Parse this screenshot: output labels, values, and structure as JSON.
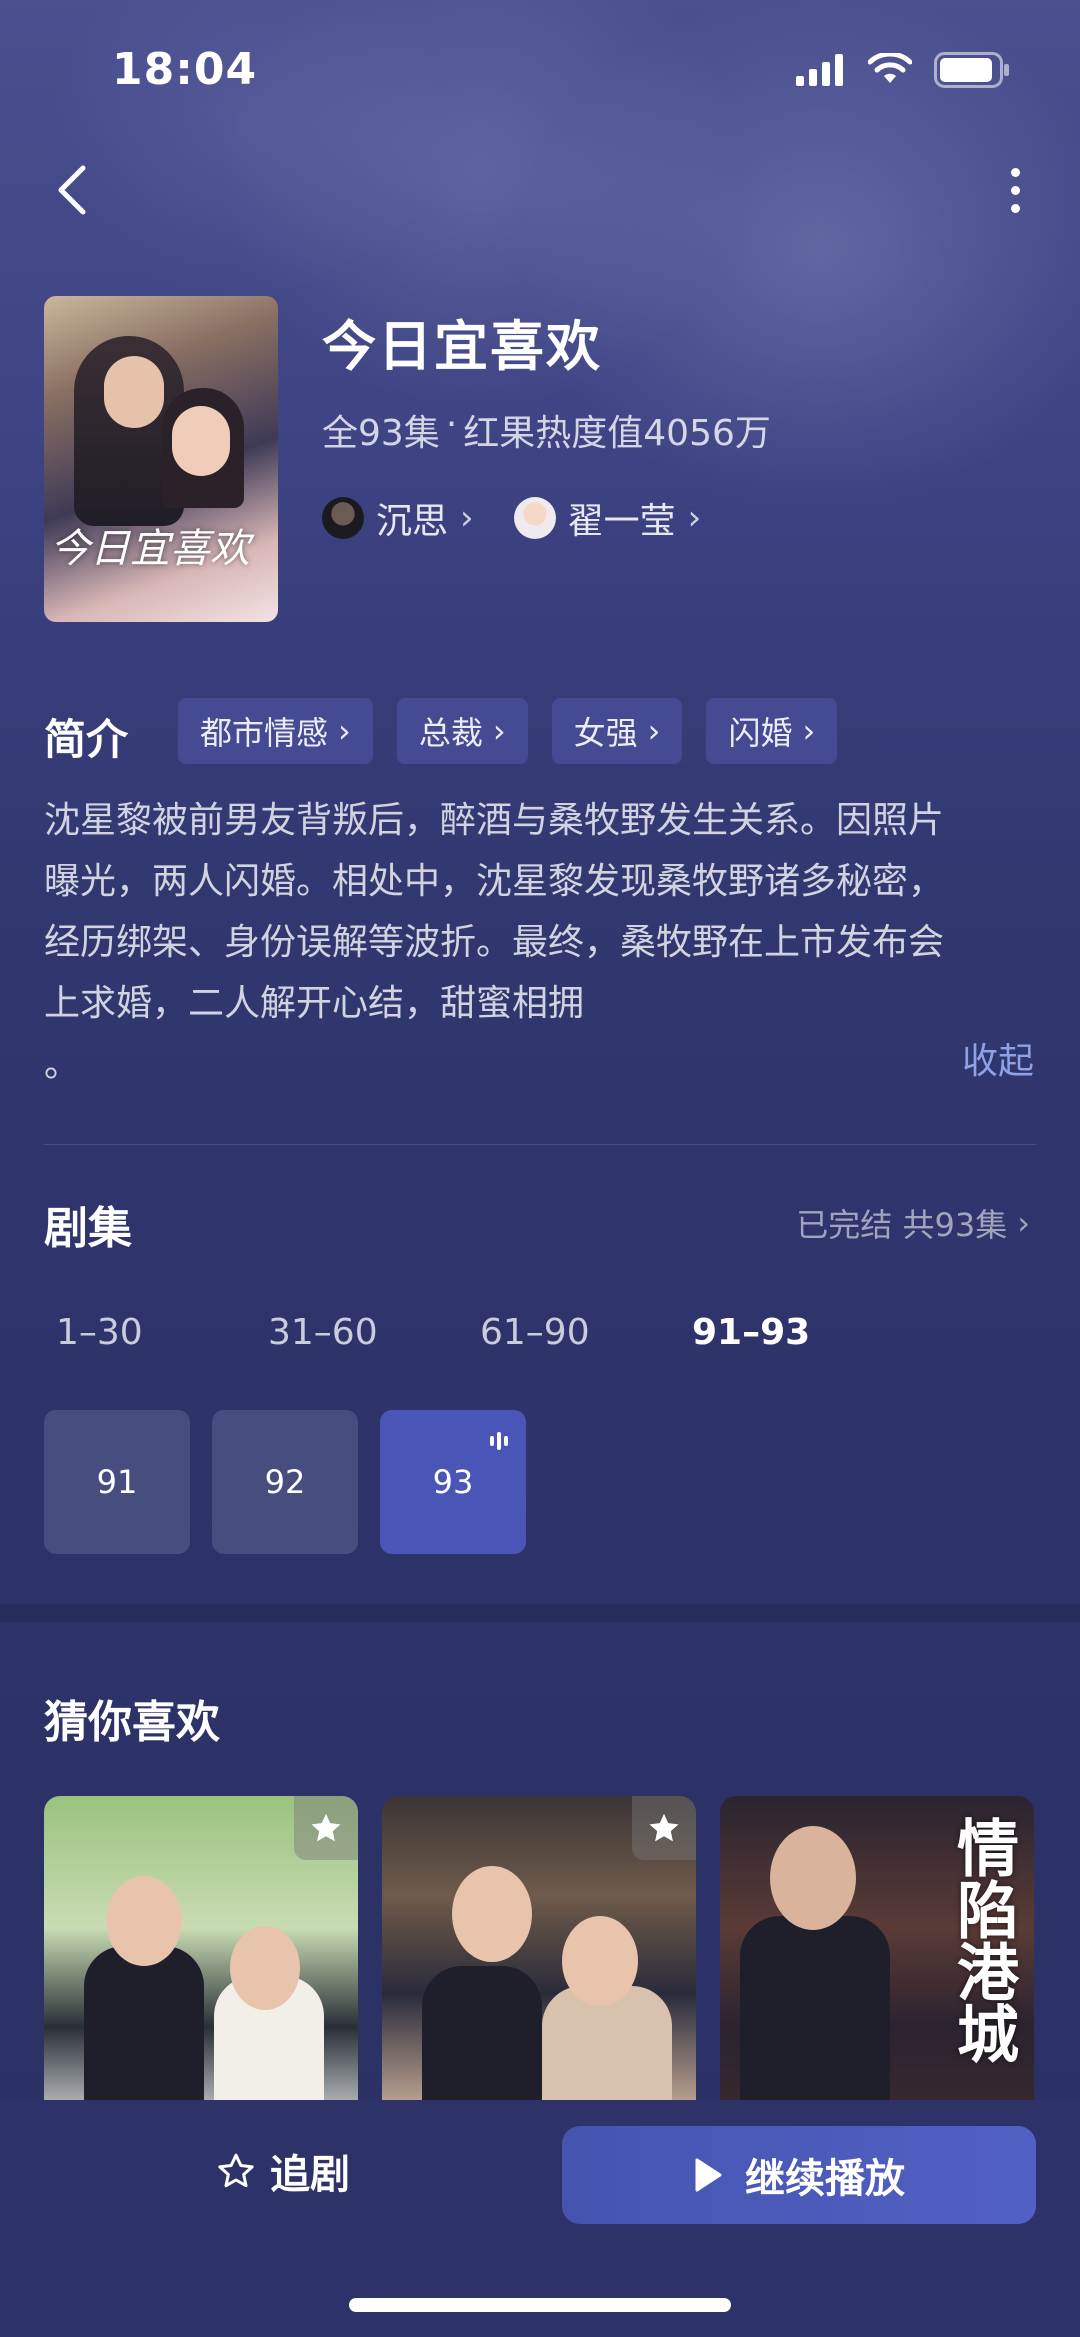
{
  "status_bar": {
    "time": "18:04"
  },
  "drama": {
    "title": "今日宜喜欢",
    "poster_title": "今日宜喜欢",
    "episodes_total": "全93集",
    "separator": "·",
    "heat": "红果热度值4056万",
    "cast": [
      {
        "name": "沉思"
      },
      {
        "name": "翟一莹"
      }
    ]
  },
  "intro": {
    "label": "简介",
    "tags": [
      "都市情感",
      "总裁",
      "女强",
      "闪婚"
    ],
    "text_lines": [
      "沈星黎被前男友背叛后，醉酒与桑牧野发生关系。因照片",
      "曝光，两人闪婚。相处中，沈星黎发现桑牧野诸多秘密，",
      "经历绑架、身份误解等波折。最终，桑牧野在上市发布会",
      "上求婚，二人解开心结，甜蜜相拥",
      "。"
    ],
    "collapse_label": "收起"
  },
  "episodes": {
    "title": "剧集",
    "status": "已完结 共93集",
    "ranges": [
      "1–30",
      "31–60",
      "61–90",
      "91–93"
    ],
    "active_range_index": 3,
    "items": [
      "91",
      "92",
      "93"
    ],
    "playing_index": 2
  },
  "recommend": {
    "title": "猜你喜欢",
    "card3_title": "情陷港城"
  },
  "bottom": {
    "follow_label": "追剧",
    "play_label": "继续播放"
  },
  "colors": {
    "accent": "#4a55b8",
    "tag_bg": "#444b93",
    "link": "#8ea0e6"
  }
}
